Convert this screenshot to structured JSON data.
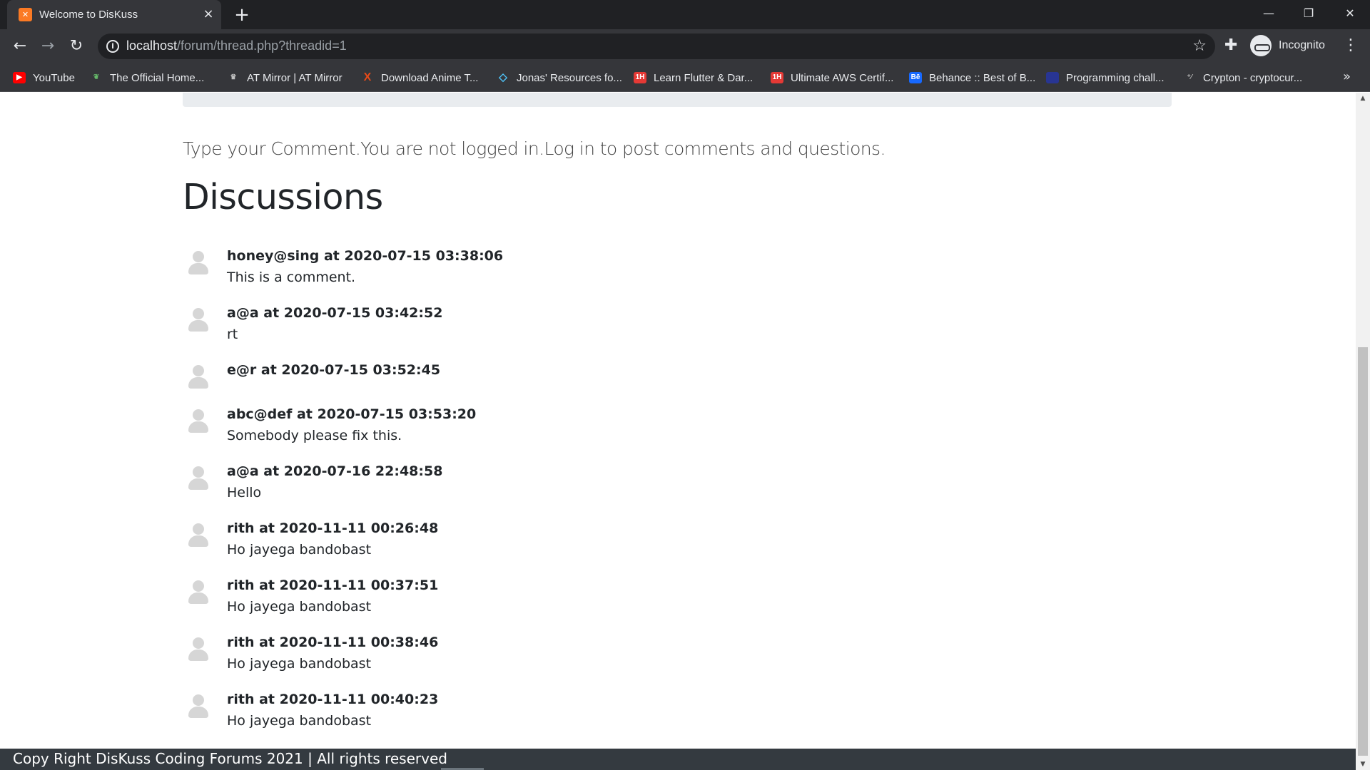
{
  "browser": {
    "tab": {
      "favicon": "xampp-icon",
      "title": "Welcome to DisKuss",
      "close": "×"
    },
    "new_tab": "+",
    "window_controls": {
      "minimize": "—",
      "restore": "❐",
      "close": "✕"
    },
    "nav": {
      "back": "←",
      "forward": "→",
      "reload": "↻"
    },
    "address": {
      "host": "localhost",
      "path": "/forum/thread.php?threadid=1"
    },
    "incognito_label": "Incognito",
    "bookmarks": [
      {
        "label": "YouTube",
        "icon": "youtube-icon",
        "color": "#ff0000"
      },
      {
        "label": "The Official Home...",
        "icon": "leaf-icon",
        "color": "#2e7d32"
      },
      {
        "label": "AT Mirror | AT Mirror",
        "icon": "mirror-icon",
        "color": "#5f6368"
      },
      {
        "label": "Download Anime T...",
        "icon": "x-icon",
        "color": "#e64a19"
      },
      {
        "label": "Jonas' Resources fo...",
        "icon": "diamond-icon",
        "color": "#4fc3f7"
      },
      {
        "label": "Learn Flutter & Dar...",
        "icon": "1h-icon",
        "color": "#e53935"
      },
      {
        "label": "Ultimate AWS Certif...",
        "icon": "1h-icon",
        "color": "#e53935"
      },
      {
        "label": "Behance :: Best of B...",
        "icon": "behance-icon",
        "color": "#1769ff"
      },
      {
        "label": "Programming chall...",
        "icon": "code-icon",
        "color": "#3949ab"
      },
      {
        "label": "Crypton - cryptocur...",
        "icon": "crypto-icon",
        "color": "#9e9e9e"
      }
    ],
    "bookmarks_more": "»"
  },
  "page": {
    "login_notice": "Type your Comment.You are not logged in.Log in to post comments and questions.",
    "discussions_title": "Discussions",
    "comments": [
      {
        "meta": "honey@sing at 2020-07-15 03:38:06",
        "text": "This is a comment."
      },
      {
        "meta": "a@a at 2020-07-15 03:42:52",
        "text": "rt"
      },
      {
        "meta": "e@r at 2020-07-15 03:52:45",
        "text": ""
      },
      {
        "meta": "abc@def at 2020-07-15 03:53:20",
        "text": "Somebody please fix this."
      },
      {
        "meta": "a@a at 2020-07-16 22:48:58",
        "text": "Hello"
      },
      {
        "meta": "rith at 2020-11-11 00:26:48",
        "text": "Ho jayega bandobast"
      },
      {
        "meta": "rith at 2020-11-11 00:37:51",
        "text": "Ho jayega bandobast"
      },
      {
        "meta": "rith at 2020-11-11 00:38:46",
        "text": "Ho jayega bandobast"
      },
      {
        "meta": "rith at 2020-11-11 00:40:23",
        "text": "Ho jayega bandobast"
      }
    ],
    "footer_text": "Copy Right DisKuss Coding Forums 2021 | All rights reserved"
  },
  "colors": {
    "chrome_dark": "#202124",
    "chrome_toolbar": "#35363a",
    "footer_bg": "#343a40",
    "text_primary": "#212529"
  }
}
